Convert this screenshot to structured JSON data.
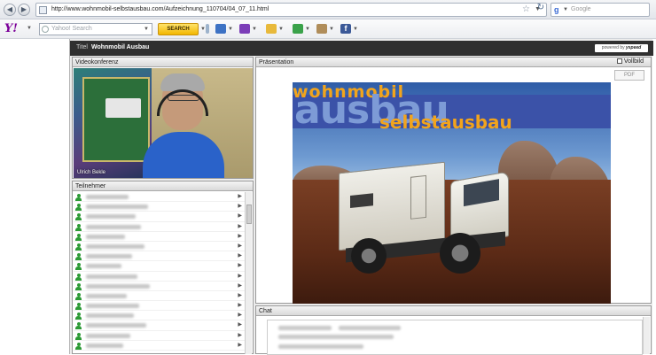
{
  "browser": {
    "url": "http://www.wohnmobil-selbstausbau.com/Aufzeichnung_110704/04_07_11.html",
    "search_engine": "Google",
    "search_placeholder": "Google",
    "back_icon": "back-arrow-icon",
    "forward_icon": "forward-arrow-icon"
  },
  "yahoo_toolbar": {
    "logo": "Y!",
    "search_placeholder": "Yahoo! Search",
    "search_button": "SEARCH"
  },
  "app": {
    "title_label": "Titel",
    "title_value": "Wohnmobil Ausbau",
    "powered_prefix": "powered by",
    "powered_brand": "yspeed",
    "video": {
      "header": "Videokonferenz",
      "presenter_name": "Ulrich Bekle"
    },
    "participants": {
      "header": "Teilnehmer",
      "rows": 16
    },
    "presentation": {
      "header": "Präsentation",
      "fullscreen_label": "Vollbild",
      "pdf_button": "PDF",
      "slide": {
        "line1": "wohnmobil",
        "line2": "ausbau",
        "line3": "selbstausbau"
      }
    },
    "chat": {
      "header": "Chat"
    }
  },
  "colors": {
    "title_bar": "#303030",
    "yahoo_purple": "#7b0099",
    "slide_orange": "#f2a41c",
    "slide_blue": "#3b52a8",
    "participant_green": "#2c9a35"
  }
}
